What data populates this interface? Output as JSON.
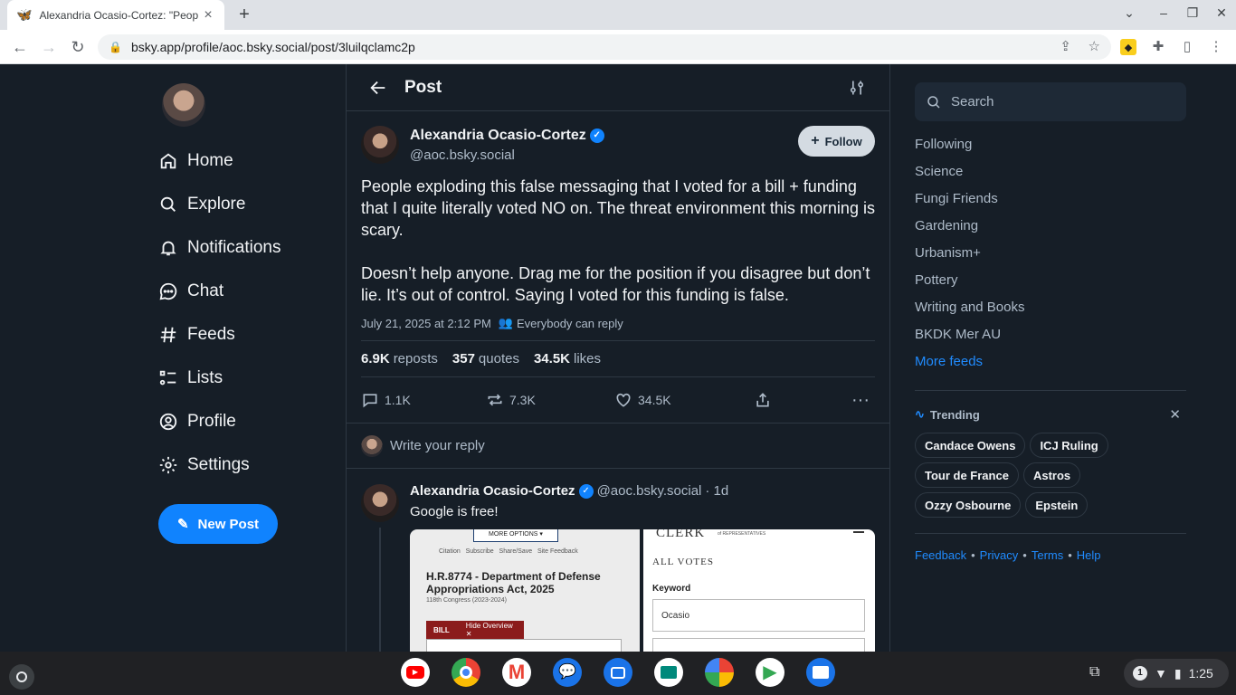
{
  "browser": {
    "tab_title": "Alexandria Ocasio-Cortez: \"Peop",
    "url": "bsky.app/profile/aoc.bsky.social/post/3luilqclamc2p"
  },
  "nav": [
    {
      "label": "Home",
      "icon": "home-icon"
    },
    {
      "label": "Explore",
      "icon": "search-icon"
    },
    {
      "label": "Notifications",
      "icon": "bell-icon"
    },
    {
      "label": "Chat",
      "icon": "chat-icon"
    },
    {
      "label": "Feeds",
      "icon": "hash-icon"
    },
    {
      "label": "Lists",
      "icon": "list-icon"
    },
    {
      "label": "Profile",
      "icon": "user-icon"
    },
    {
      "label": "Settings",
      "icon": "gear-icon"
    }
  ],
  "new_post_label": "New Post",
  "header": {
    "title": "Post"
  },
  "post": {
    "author": "Alexandria Ocasio-Cortez",
    "handle": "@aoc.bsky.social",
    "follow_label": "Follow",
    "text1": "People exploding this false messaging that I voted for a bill + funding that I quite literally voted NO on. The threat environment this morning is scary.",
    "text2": "Doesn’t help anyone. Drag me for the position if you disagree but don’t lie. It’s out of control. Saying I voted for this funding is false.",
    "date": "July 21, 2025 at 2:12 PM",
    "reply_setting": "Everybody can reply",
    "reposts_count": "6.9K",
    "reposts_label": "reposts",
    "quotes_count": "357",
    "quotes_label": "quotes",
    "likes_count": "34.5K",
    "likes_label": "likes",
    "replies": "1.1K",
    "repost_btn": "7.3K",
    "like_btn": "34.5K"
  },
  "reply_placeholder": "Write your reply",
  "reply_post": {
    "author": "Alexandria Ocasio-Cortez",
    "handle": "@aoc.bsky.social",
    "age": "· 1d",
    "text": "Google is free!",
    "img1": {
      "more": "MORE OPTIONS ▾",
      "links": "Citation   Subscribe   Share/Save   Site Feedback",
      "title": "H.R.8774 - Department of Defense Appropriations Act, 2025",
      "congress": "118th Congress (2023-2024)",
      "bill": "BILL",
      "hide": "Hide Overview ✕"
    },
    "img2": {
      "clerk": "CLERK",
      "clerk_sub": "of REPRESENTATIVES",
      "all_votes": "ALL VOTES",
      "keyword": "Keyword",
      "value": "Ocasio"
    }
  },
  "sidebar": {
    "search_placeholder": "Search",
    "feeds": [
      "Following",
      "Science",
      "Fungi Friends",
      "Gardening",
      "Urbanism+",
      "Pottery",
      "Writing and Books",
      "BKDK Mer AU"
    ],
    "more_feeds": "More feeds",
    "trending_title": "Trending",
    "trending": [
      "Candace Owens",
      "ICJ Ruling",
      "Tour de France",
      "Astros",
      "Ozzy Osbourne",
      "Epstein"
    ],
    "footer": [
      "Feedback",
      "Privacy",
      "Terms",
      "Help"
    ]
  },
  "shelf": {
    "notification_count": "1",
    "time": "1:25",
    "apps": [
      "youtube-icon",
      "chrome-icon",
      "gmail-icon",
      "messages-icon",
      "camera-icon",
      "meet-icon",
      "photos-icon",
      "play-store-icon",
      "files-icon"
    ]
  },
  "colors": {
    "accent": "#1083fe",
    "bg": "#161e27",
    "link": "#208bfe"
  }
}
